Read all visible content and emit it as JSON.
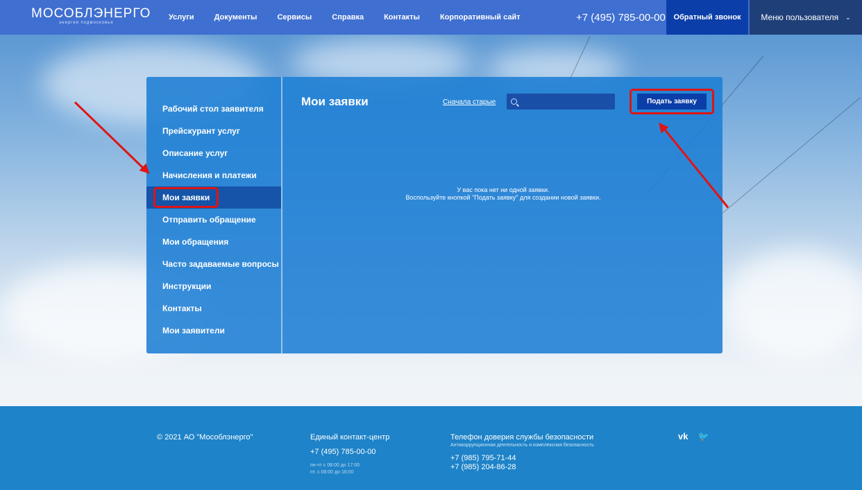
{
  "header": {
    "logo_text": "МОСОБЛЭНЕРГО",
    "logo_subtitle": "энергия подмосковья",
    "nav": [
      "Услуги",
      "Документы",
      "Сервисы",
      "Справка",
      "Контакты",
      "Корпоративный сайт"
    ],
    "phone": "+7 (495) 785-00-00",
    "callback_label": "Обратный звонок",
    "user_menu_label": "Меню пользователя"
  },
  "sidebar": {
    "items": [
      {
        "label": "Рабочий стол заявителя"
      },
      {
        "label": "Прейскурант услуг"
      },
      {
        "label": "Описание услуг"
      },
      {
        "label": "Начисления и платежи"
      },
      {
        "label": "Мои заявки",
        "active": true
      },
      {
        "label": "Отправить обращение"
      },
      {
        "label": "Мои обращения"
      },
      {
        "label": "Часто задаваемые вопросы"
      },
      {
        "label": "Инструкции"
      },
      {
        "label": "Контакты"
      },
      {
        "label": "Мои заявители"
      }
    ]
  },
  "main": {
    "title": "Мои заявки",
    "sort_link": "Сначала старые",
    "search_value": "",
    "submit_label": "Подать заявку",
    "empty_line1": "У вас пока нет ни одной заявки.",
    "empty_line2": "Воспользуйте кнопкой \"Подать заявку\" для создании новой заявки."
  },
  "footer": {
    "copyright": "© 2021 АО \"Мособлэнерго\"",
    "contact_center_title": "Единый контакт-центр",
    "contact_center_phone": "+7 (495) 785-00-00",
    "hours_1": "пн-чт с 08:00 до 17:00",
    "hours_2": "пт. с 08:00 до 16:00",
    "security_title": "Телефон доверия службы безопасности",
    "security_subtitle": "Антикоррупционная деятельность и комплексная безопасность",
    "security_phone_1": "+7 (985) 795-71-44",
    "security_phone_2": "+7 (985) 204-86-28",
    "social": [
      {
        "icon": "vk-icon",
        "glyph": "vk"
      },
      {
        "icon": "twitter-icon",
        "glyph": "🐦"
      }
    ]
  },
  "colors": {
    "header_bg": "#3f6fd0",
    "accent_dark": "#0b3ea8",
    "panel_bg": "#1e7ed4",
    "highlight": "#e01414",
    "footer_bg": "#1e83c8"
  }
}
